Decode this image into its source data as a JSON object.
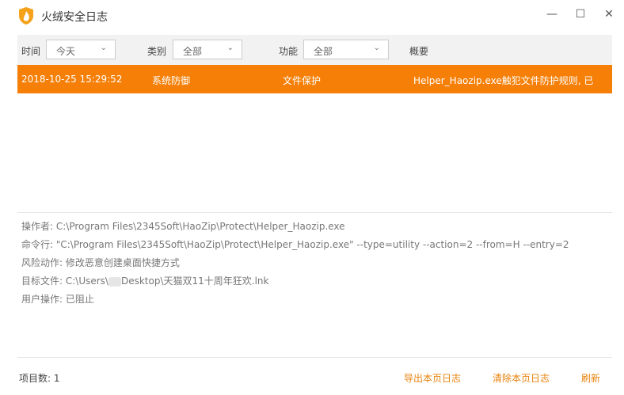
{
  "window": {
    "title": "火绒安全日志"
  },
  "colors": {
    "accent": "#f57f07",
    "link": "#e8830d"
  },
  "filters": {
    "time": {
      "label": "时间",
      "value": "今天"
    },
    "category": {
      "label": "类别",
      "value": "全部"
    },
    "function": {
      "label": "功能",
      "value": "全部"
    },
    "summary_label": "概要"
  },
  "rows": [
    {
      "time": "2018-10-25 15:29:52",
      "category": "系统防御",
      "function": "文件保护",
      "summary": "Helper_Haozip.exe触犯文件防护规则, 已"
    }
  ],
  "details": {
    "operator": "操作者: C:\\Program Files\\2345Soft\\HaoZip\\Protect\\Helper_Haozip.exe",
    "cmdline": "命令行: \"C:\\Program Files\\2345Soft\\HaoZip\\Protect\\Helper_Haozip.exe\" --type=utility --action=2 --from=H --entry=2",
    "risk": "风险动作: 修改恶意创建桌面快捷方式",
    "target_prefix": "目标文件: C:\\Users\\",
    "target_suffix": "Desktop\\天猫双11十周年狂欢.lnk",
    "user_action": "用户操作: 已阻止"
  },
  "footer": {
    "count": "项目数: 1",
    "export": "导出本页日志",
    "clear": "清除本页日志",
    "refresh": "刷新"
  }
}
